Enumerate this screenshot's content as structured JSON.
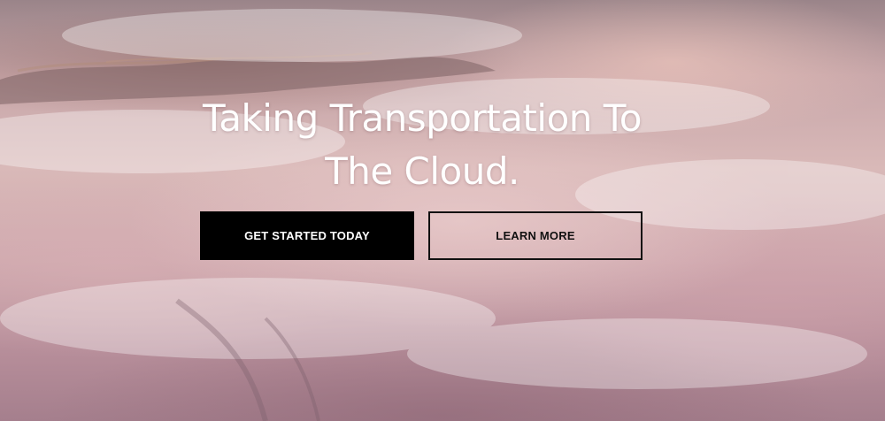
{
  "hero": {
    "headline_line1": "Taking Transportation To",
    "headline_line2": "The Cloud.",
    "primary_button_label": "GET STARTED TODAY",
    "secondary_button_label": "LEARN MORE"
  },
  "colors": {
    "primary_button_bg": "#000000",
    "primary_button_text": "#ffffff",
    "secondary_button_border": "#111111",
    "headline_text": "#ffffff"
  }
}
